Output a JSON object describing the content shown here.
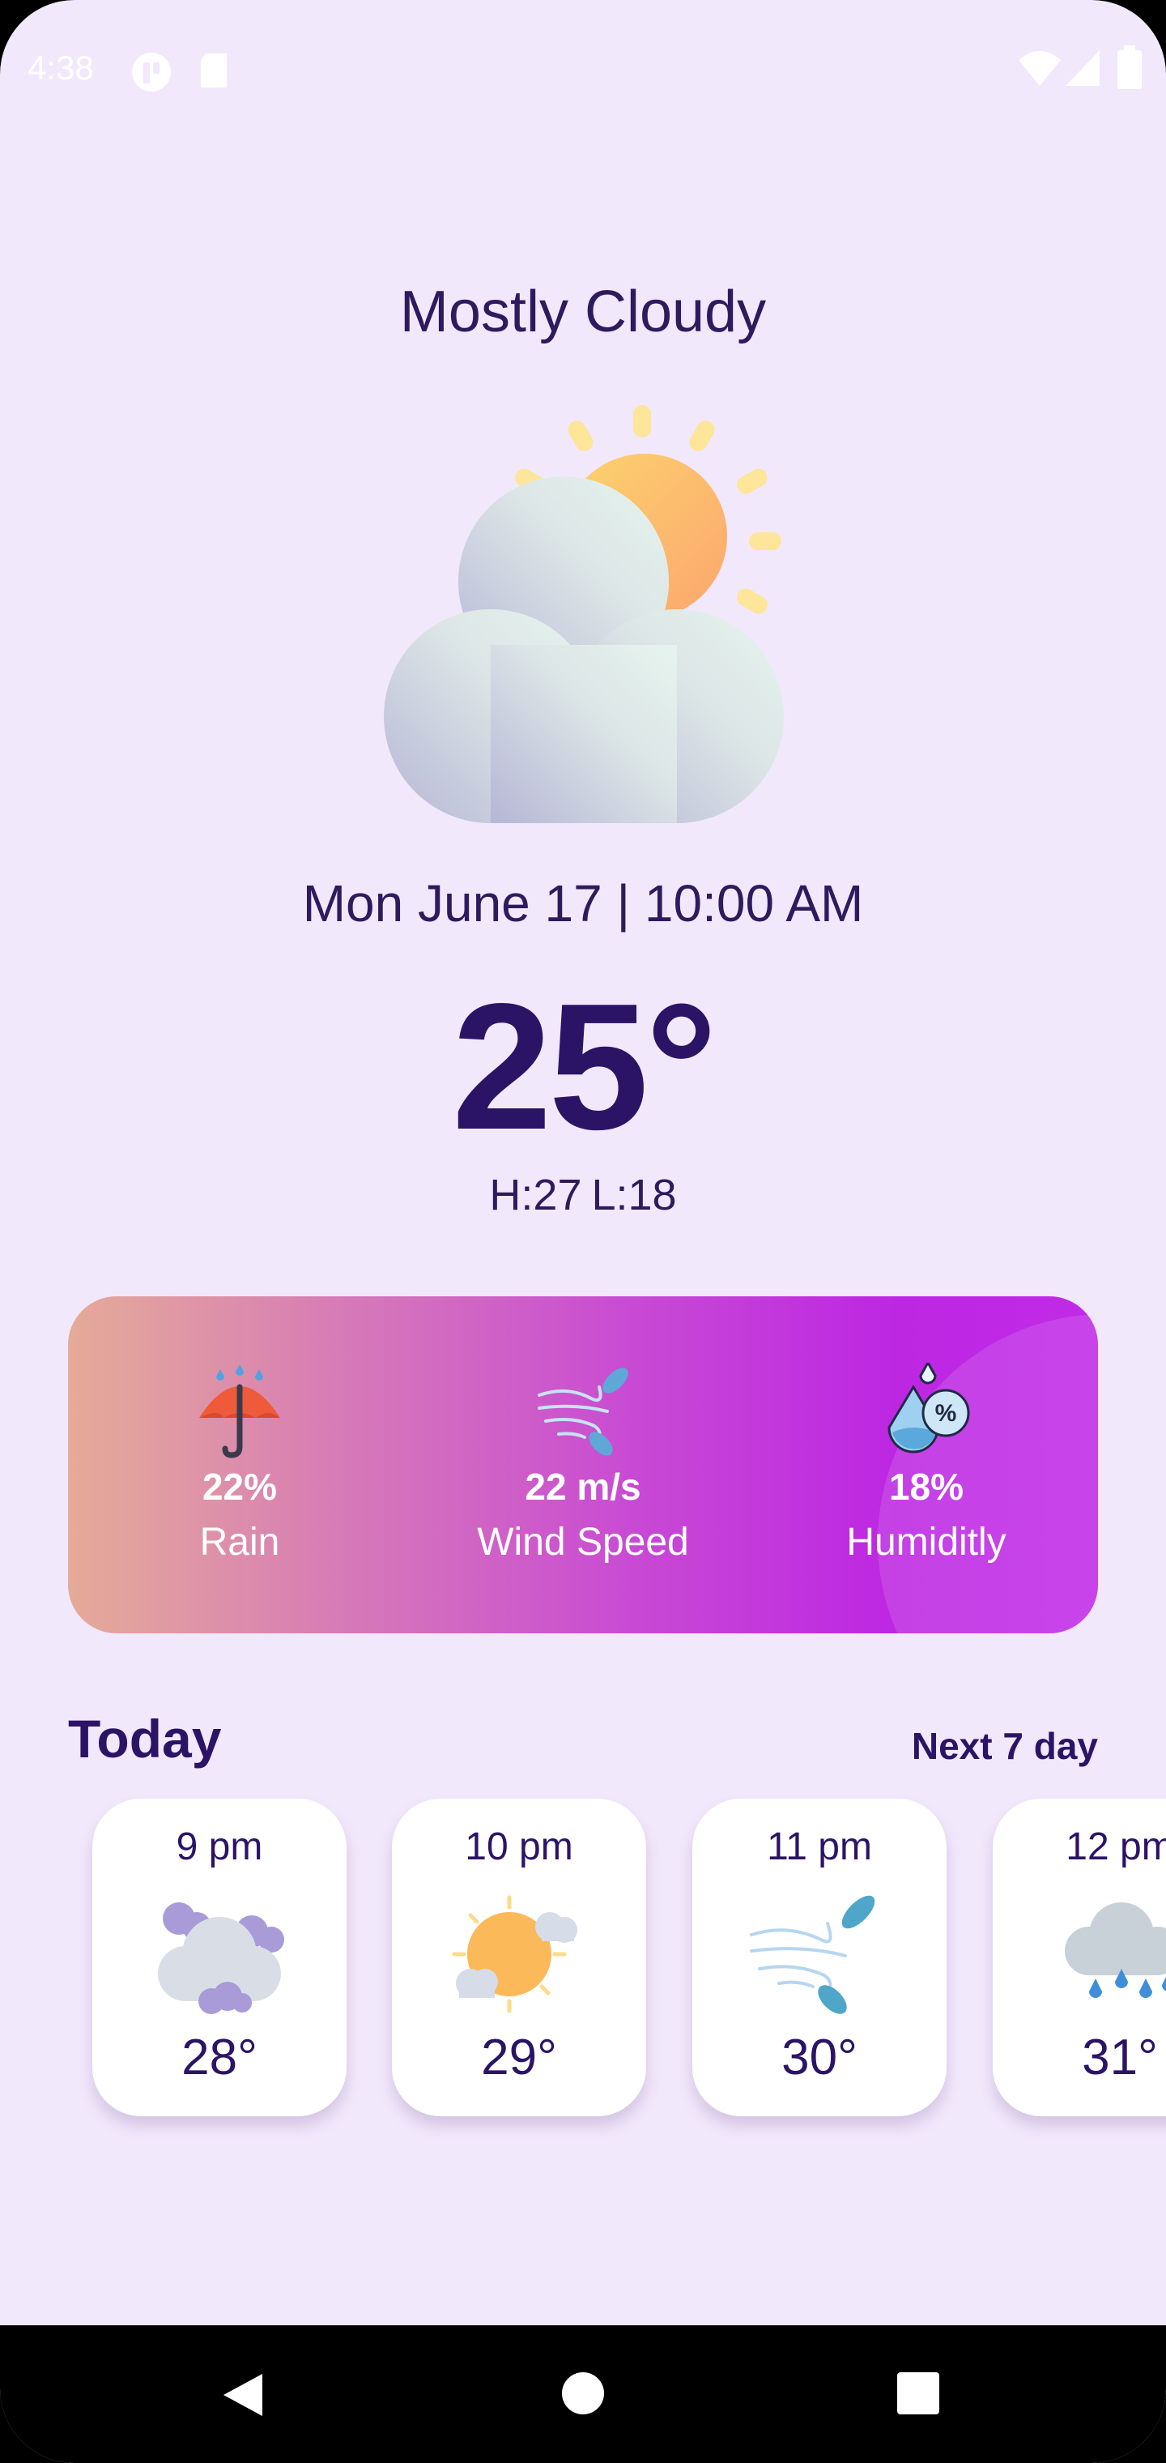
{
  "status_bar": {
    "time": "4:38"
  },
  "weather": {
    "condition": "Mostly Cloudy",
    "datetime": "Mon June 17 | 10:00 AM",
    "temperature": "25°",
    "high": "H:27",
    "low": "L:18",
    "icon": "partly-cloudy-icon"
  },
  "stats": [
    {
      "icon": "umbrella-icon",
      "value": "22%",
      "label": "Rain"
    },
    {
      "icon": "wind-icon",
      "value": "22 m/s",
      "label": "Wind Speed"
    },
    {
      "icon": "humidity-icon",
      "value": "18%",
      "label": "Humiditly"
    }
  ],
  "today": {
    "title": "Today",
    "next_link": "Next 7 day",
    "hours": [
      {
        "time": "9 pm",
        "icon": "cloudy-icon",
        "temp": "28°"
      },
      {
        "time": "10 pm",
        "icon": "sunny-cloud-icon",
        "temp": "29°"
      },
      {
        "time": "11 pm",
        "icon": "wind-icon",
        "temp": "30°"
      },
      {
        "time": "12 pm",
        "icon": "rain-cloud-icon",
        "temp": "31°"
      }
    ]
  },
  "colors": {
    "background": "#f2e8fb",
    "primary_text": "#2b1466",
    "card_gradient_start": "#e5ab98",
    "card_gradient_end": "#c12ae8"
  }
}
